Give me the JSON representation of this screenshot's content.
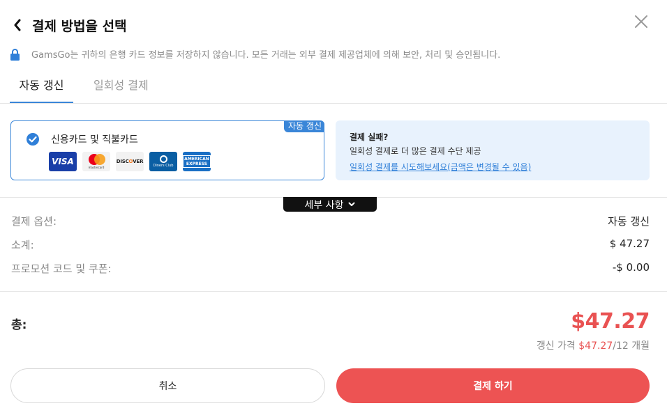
{
  "header": {
    "title": "결제 방법을 선택",
    "back_icon": "chevron-left-icon",
    "close_icon": "close-icon"
  },
  "notice": {
    "icon": "lock-icon",
    "text": "GamsGo는 귀하의 은행 카드 정보를 저장하지 않습니다. 모든 거래는 외부 결제 제공업체에 의해 보안, 처리 및 승인됩니다."
  },
  "tabs": [
    {
      "label": "자동 갱신",
      "active": true
    },
    {
      "label": "일회성 결제",
      "active": false
    }
  ],
  "card_option": {
    "badge": "자동 갱신",
    "title": "신용카드 및 직불카드",
    "selected": true,
    "logos": {
      "visa": "VISA",
      "mastercard": "mastercard",
      "discover_a": "DISC",
      "discover_o": "O",
      "discover_b": "VER",
      "diners": "Diners Club",
      "amex_1": "AMERICAN",
      "amex_2": "EXPRESS"
    }
  },
  "fail_box": {
    "title": "결제 실패?",
    "desc": "일회성 결제로 더 많은 결제 수단 제공",
    "link": "일회성 결제를 시도해보세요(금액은 변경될 수 있음)"
  },
  "details": {
    "label": "세부 사항",
    "icon": "chevron-down-icon"
  },
  "summary": {
    "option_label": "결제 옵션:",
    "option_value": "자동 갱신",
    "subtotal_label": "소계:",
    "subtotal_value": "$ 47.27",
    "promo_label": "프로모션 코드 및 쿠폰:",
    "promo_value": "-$ 0.00"
  },
  "total": {
    "label": "총:",
    "amount": "$47.27",
    "renew_prefix": "갱신 가격 ",
    "renew_price": "$47.27",
    "renew_suffix": "/12 개월"
  },
  "buttons": {
    "cancel": "취소",
    "pay": "결제 하기"
  },
  "colors": {
    "accent": "#3a86d8",
    "price_red": "#e95252",
    "pay_button": "#ed5353",
    "fail_bg": "#e8f2fd"
  }
}
